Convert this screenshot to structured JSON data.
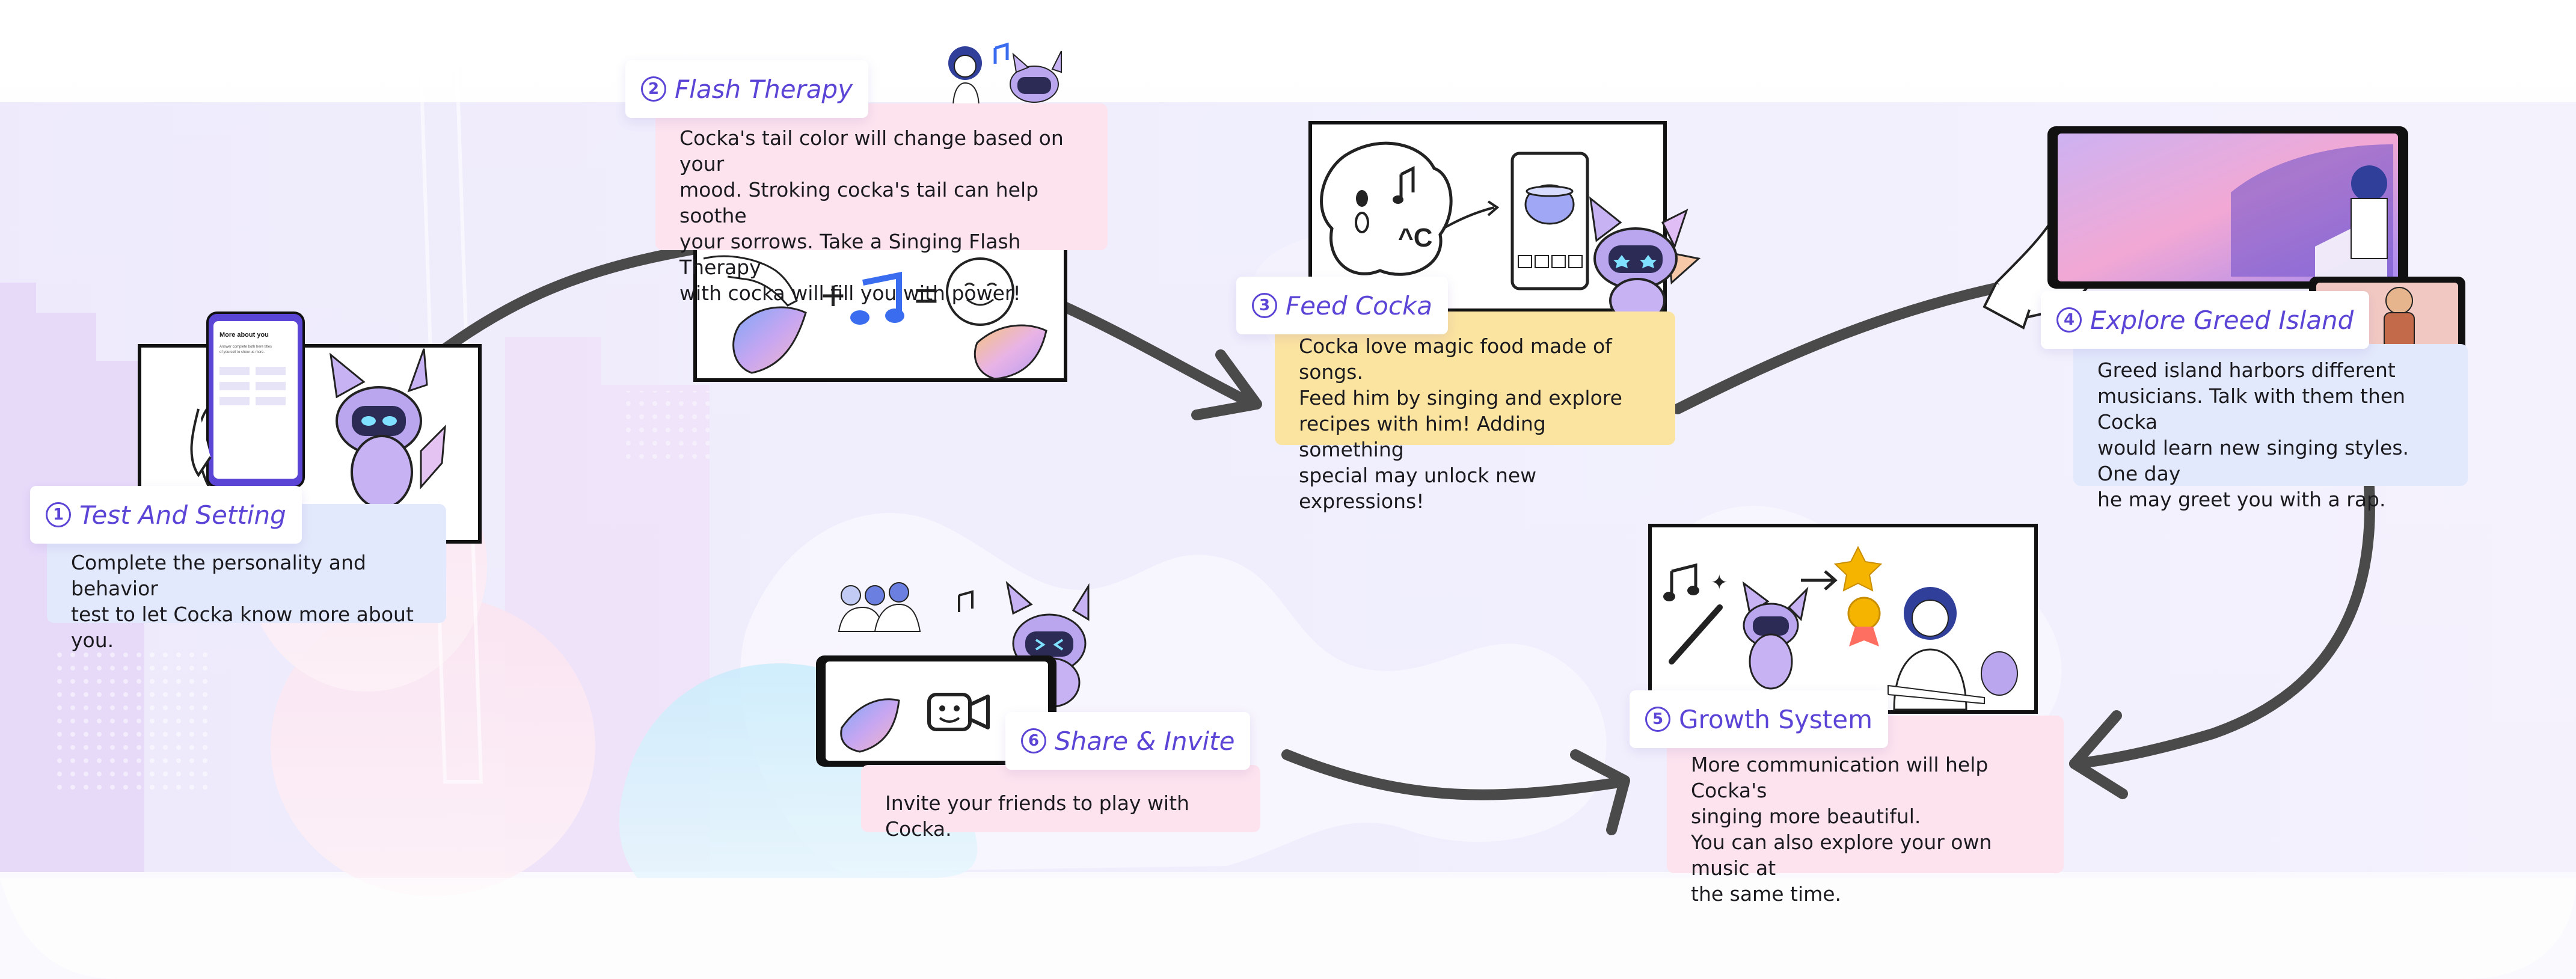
{
  "colors": {
    "accent": "#5b45d6",
    "card_blue": "#e3e9fc",
    "card_pink": "#fde3ee",
    "card_yellow": "#fbe3a0",
    "arrow": "#4a4a4a"
  },
  "steps": [
    {
      "number": "1",
      "title": "Test And Setting",
      "description": [
        "Complete the personality and behavior",
        "test to let Cocka know more about you."
      ],
      "card_color": "blue"
    },
    {
      "number": "2",
      "title": "Flash Therapy",
      "description": [
        "Cocka's tail color will change based on your",
        "mood. Stroking cocka's tail can help soothe",
        "your sorrows. Take a Singing Flash Therapy",
        "with cocka will fill you with power!"
      ],
      "card_color": "pink"
    },
    {
      "number": "3",
      "title": "Feed Cocka",
      "description": [
        "Cocka love magic food made of songs.",
        "Feed him by singing and explore",
        "recipes with him! Adding something",
        "special may unlock new expressions!"
      ],
      "card_color": "yellow"
    },
    {
      "number": "4",
      "title": "Explore Greed Island",
      "description": [
        "Greed island harbors different",
        "musicians. Talk with them then Cocka",
        "would learn new singing styles. One day",
        "he may greet you with a rap."
      ],
      "card_color": "blue"
    },
    {
      "number": "5",
      "title": "Growth System",
      "description": [
        "More communication will help Cocka's",
        "singing more beautiful.",
        "You can also explore your own music at",
        "the same time."
      ],
      "card_color": "pink"
    },
    {
      "number": "6",
      "title": "Share & Invite",
      "description": [
        "Invite your friends to play with Cocka."
      ],
      "card_color": "pink"
    }
  ],
  "phone_screen": {
    "title": "More about you",
    "lines": [
      "Answer complete both here titles",
      "of yourself to show us more."
    ]
  },
  "feed_illustration": {
    "sound_text": "^C"
  },
  "icons": [
    "hand-icon",
    "music-note-icon",
    "smiley-face-icon",
    "tail-icon",
    "robot-cocka-icon",
    "cauldron-icon",
    "video-camera-icon",
    "star-icon",
    "medal-icon",
    "magic-wand-icon",
    "pointing-hand-icon"
  ]
}
